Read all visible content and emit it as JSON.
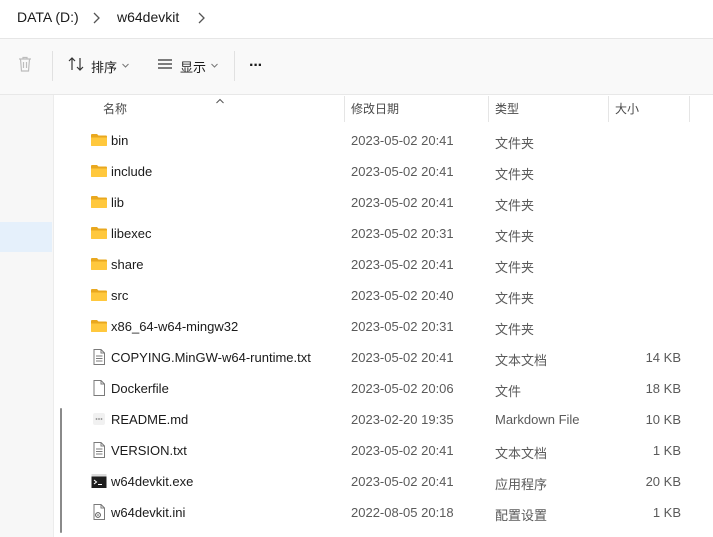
{
  "address": {
    "crumbs": [
      "DATA (D:)",
      "w64devkit"
    ]
  },
  "toolbar": {
    "sort_label": "排序",
    "view_label": "显示",
    "more_label": "···"
  },
  "columns": {
    "name": "名称",
    "date": "修改日期",
    "type": "类型",
    "size": "大小"
  },
  "files": [
    {
      "name": "bin",
      "date": "2023-05-02 20:41",
      "type": "文件夹",
      "size": "",
      "icon": "folder-icon"
    },
    {
      "name": "include",
      "date": "2023-05-02 20:41",
      "type": "文件夹",
      "size": "",
      "icon": "folder-icon"
    },
    {
      "name": "lib",
      "date": "2023-05-02 20:41",
      "type": "文件夹",
      "size": "",
      "icon": "folder-icon"
    },
    {
      "name": "libexec",
      "date": "2023-05-02 20:31",
      "type": "文件夹",
      "size": "",
      "icon": "folder-icon"
    },
    {
      "name": "share",
      "date": "2023-05-02 20:41",
      "type": "文件夹",
      "size": "",
      "icon": "folder-icon"
    },
    {
      "name": "src",
      "date": "2023-05-02 20:40",
      "type": "文件夹",
      "size": "",
      "icon": "folder-icon"
    },
    {
      "name": "x86_64-w64-mingw32",
      "date": "2023-05-02 20:31",
      "type": "文件夹",
      "size": "",
      "icon": "folder-icon"
    },
    {
      "name": "COPYING.MinGW-w64-runtime.txt",
      "date": "2023-05-02 20:41",
      "type": "文本文档",
      "size": "14 KB",
      "icon": "text-file-icon"
    },
    {
      "name": "Dockerfile",
      "date": "2023-05-02 20:06",
      "type": "文件",
      "size": "18 KB",
      "icon": "file-icon"
    },
    {
      "name": "README.md",
      "date": "2023-02-20 19:35",
      "type": "Markdown File",
      "size": "10 KB",
      "icon": "markdown-file-icon"
    },
    {
      "name": "VERSION.txt",
      "date": "2023-05-02 20:41",
      "type": "文本文档",
      "size": "1 KB",
      "icon": "text-file-icon"
    },
    {
      "name": "w64devkit.exe",
      "date": "2023-05-02 20:41",
      "type": "应用程序",
      "size": "20 KB",
      "icon": "exe-file-icon"
    },
    {
      "name": "w64devkit.ini",
      "date": "2022-08-05 20:18",
      "type": "配置设置",
      "size": "1 KB",
      "icon": "ini-file-icon"
    }
  ]
}
